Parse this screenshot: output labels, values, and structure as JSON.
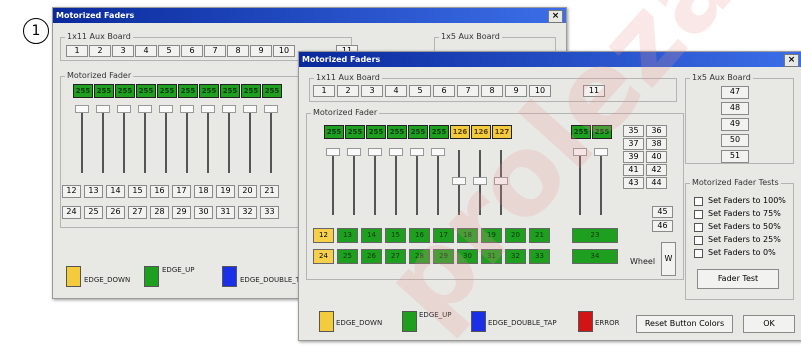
{
  "callout": "1",
  "back_window": {
    "title": "Motorized Faders",
    "close": "×",
    "aux11_label": "1x11 Aux Board",
    "aux11_buttons": [
      "1",
      "2",
      "3",
      "4",
      "5",
      "6",
      "7",
      "8",
      "9",
      "10"
    ],
    "aux11_extra": "11",
    "aux5_label": "1x5 Aux Board",
    "fader_label": "Motorized Fader",
    "lcd_values": [
      "255",
      "255",
      "255",
      "255",
      "255",
      "255",
      "255",
      "255",
      "255",
      "255"
    ],
    "row1": [
      "12",
      "13",
      "14",
      "15",
      "16",
      "17",
      "18",
      "19",
      "20",
      "21"
    ],
    "row2": [
      "24",
      "25",
      "26",
      "27",
      "28",
      "29",
      "30",
      "31",
      "32",
      "33"
    ],
    "legend": [
      "EDGE_DOWN",
      "EDGE_UP",
      "EDGE_DOUBLE_T"
    ]
  },
  "front_window": {
    "title": "Motorized Faders",
    "close": "×",
    "aux11_label": "1x11 Aux Board",
    "aux11_buttons": [
      "1",
      "2",
      "3",
      "4",
      "5",
      "6",
      "7",
      "8",
      "9",
      "10"
    ],
    "aux11_extra": "11",
    "aux5_label": "1x5 Aux Board",
    "aux5_buttons": [
      "47",
      "48",
      "49",
      "50",
      "51"
    ],
    "fader_label": "Motorized Fader",
    "lcd_values": [
      "255",
      "255",
      "255",
      "255",
      "255",
      "255",
      "126",
      "126",
      "127"
    ],
    "lcd_right": [
      "255",
      "255"
    ],
    "side_buttons": [
      [
        "35",
        "36"
      ],
      [
        "37",
        "38"
      ],
      [
        "39",
        "40"
      ],
      [
        "41",
        "42"
      ],
      [
        "43",
        "44"
      ]
    ],
    "side_45": "45",
    "side_46": "46",
    "row1": [
      "12",
      "13",
      "14",
      "15",
      "16",
      "17",
      "18",
      "19",
      "20",
      "21"
    ],
    "row1_right": "23",
    "row2": [
      "24",
      "25",
      "26",
      "27",
      "28",
      "29",
      "30",
      "31",
      "32",
      "33"
    ],
    "row2_right": "34",
    "wheel_label": "Wheel",
    "wheel_button": "W",
    "tests_label": "Motorized Fader Tests",
    "tests": [
      "Set Faders to 100%",
      "Set Faders to 75%",
      "Set Faders to 50%",
      "Set Faders to 25%",
      "Set Faders to 0%"
    ],
    "fader_test": "Fader Test",
    "legend": [
      "EDGE_DOWN",
      "EDGE_UP",
      "EDGE_DOUBLE_TAP",
      "ERROR"
    ],
    "reset": "Reset Button Colors",
    "ok": "OK",
    "colors": {
      "edge_down": "#f3cb3c",
      "edge_up": "#1f9f1f",
      "edge_double_tap": "#1a2fe6",
      "error": "#d21414"
    }
  }
}
